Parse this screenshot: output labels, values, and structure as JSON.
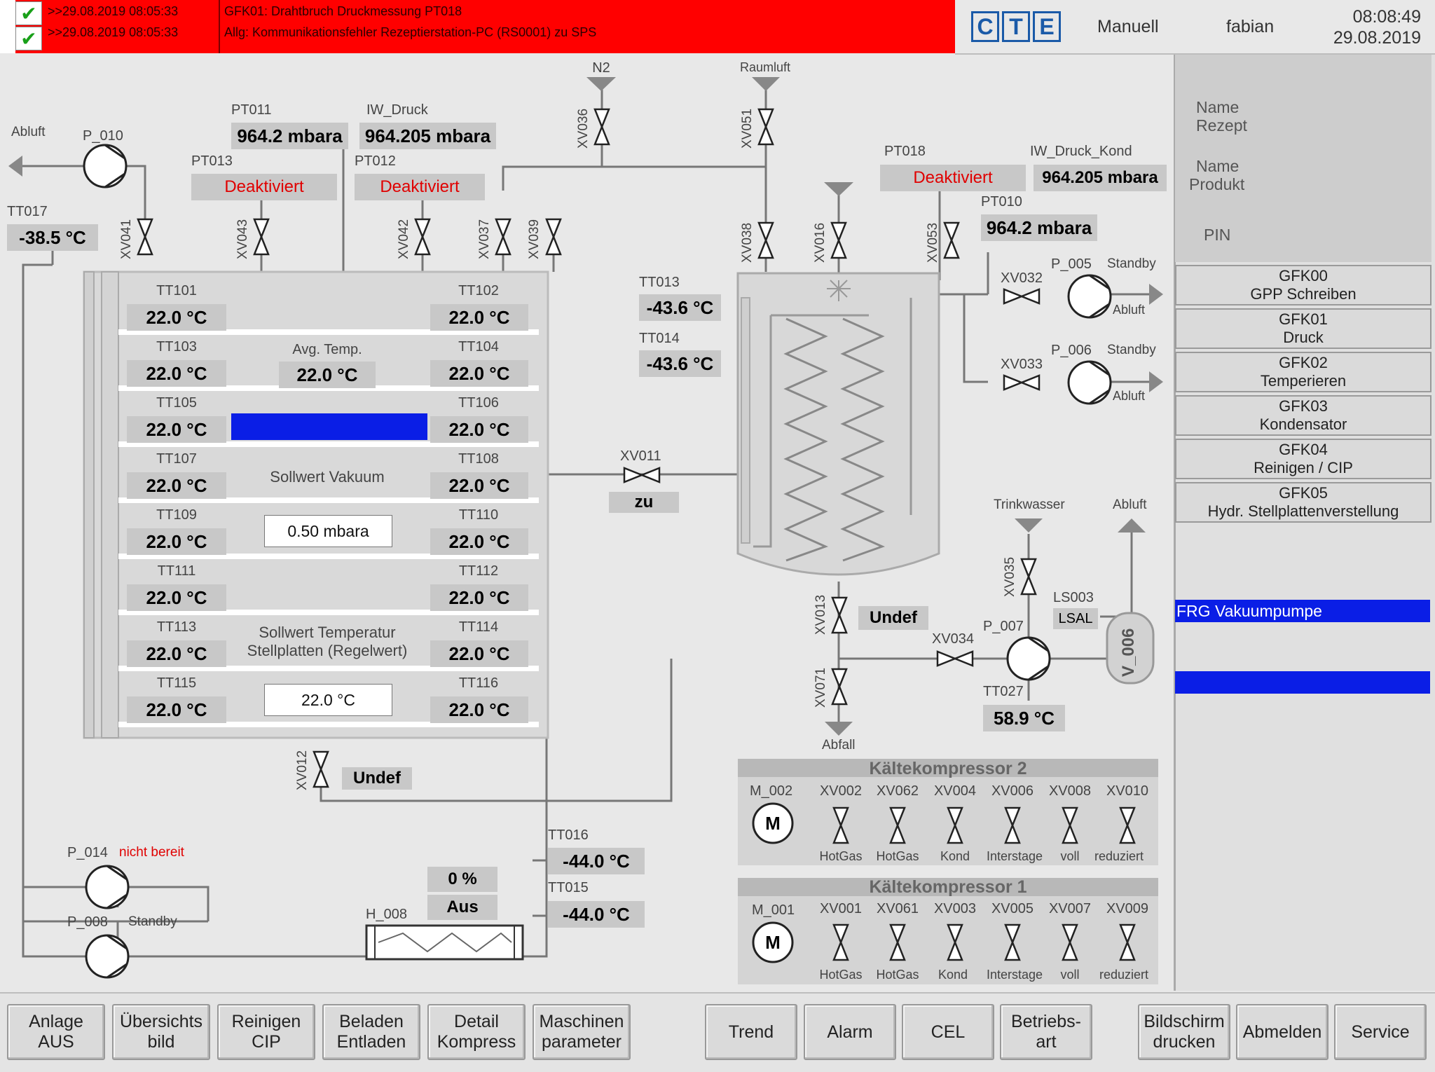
{
  "alarms": [
    {
      "timestamp": ">>29.08.2019 08:05:33",
      "message": "GFK01: Drahtbruch Druckmessung PT018"
    },
    {
      "timestamp": ">>29.08.2019 08:05:33",
      "message": "Allg: Kommunikationsfehler Rezeptierstation-PC (RS0001) zu SPS"
    }
  ],
  "header": {
    "logo": [
      "C",
      "T",
      "E"
    ],
    "mode": "Manuell",
    "user": "fabian",
    "time": "08:08:49",
    "date": "29.08.2019"
  },
  "side": {
    "name_rezept": [
      "Name",
      "Rezept"
    ],
    "name_produkt": [
      "Name",
      "Produkt"
    ],
    "pin": "PIN",
    "buttons": [
      {
        "line1": "GFK00",
        "line2": "GPP Schreiben"
      },
      {
        "line1": "GFK01",
        "line2": "Druck"
      },
      {
        "line1": "GFK02",
        "line2": "Temperieren"
      },
      {
        "line1": "GFK03",
        "line2": "Kondensator"
      },
      {
        "line1": "GFK04",
        "line2": "Reinigen / CIP"
      },
      {
        "line1": "GFK05",
        "line2": "Hydr. Stellplattenverstellung"
      }
    ],
    "frg": "FRG Vakuumpumpe"
  },
  "process": {
    "abluft_left": "Abluft",
    "p010": "P_010",
    "tt017": {
      "tag": "TT017",
      "value": "-38.5 °C"
    },
    "pt011": {
      "tag": "PT011",
      "value": "964.2 mbara"
    },
    "iw_druck": {
      "tag": "IW_Druck",
      "value": "964.205 mbara"
    },
    "pt013": {
      "tag": "PT013",
      "value": "Deaktiviert"
    },
    "pt012": {
      "tag": "PT012",
      "value": "Deaktiviert"
    },
    "n2": "N2",
    "raumluft": "Raumluft",
    "valves": {
      "xv041": "XV041",
      "xv043": "XV043",
      "xv042": "XV042",
      "xv037": "XV037",
      "xv039": "XV039",
      "xv036": "XV036",
      "xv051": "XV051",
      "xv038": "XV038",
      "xv016": "XV016",
      "xv053": "XV053",
      "xv013": "XV013",
      "xv071": "XV071",
      "xv035": "XV035",
      "xv012": "XV012"
    },
    "pt018": {
      "tag": "PT018",
      "value": "Deaktiviert"
    },
    "iw_druck_kond": {
      "tag": "IW_Druck_Kond",
      "value": "964.205 mbara"
    },
    "pt010": {
      "tag": "PT010",
      "value": "964.2 mbara"
    },
    "xv032": "XV032",
    "p005": {
      "tag": "P_005",
      "state": "Standby",
      "out": "Abluft"
    },
    "xv033": "XV033",
    "p006": {
      "tag": "P_006",
      "state": "Standby",
      "out": "Abluft"
    },
    "tt013": {
      "tag": "TT013",
      "value": "-43.6 °C"
    },
    "tt014": {
      "tag": "TT014",
      "value": "-43.6 °C"
    },
    "xv011": {
      "tag": "XV011",
      "value": "zu"
    },
    "xv013_state": "Undef",
    "xv012_state": "Undef",
    "trinkwasser": "Trinkwasser",
    "abluft_right": "Abluft",
    "ls003": {
      "tag": "LS003",
      "value": "LSAL"
    },
    "p007": "P_007",
    "xv034": "XV034",
    "v006": "V_006",
    "tt027": {
      "tag": "TT027",
      "value": "58.9 °C"
    },
    "abfall": "Abfall",
    "tt016": {
      "tag": "TT016",
      "value": "-44.0 °C"
    },
    "tt015": {
      "tag": "TT015",
      "value": "-44.0 °C"
    },
    "p014": {
      "tag": "P_014",
      "state": "nicht bereit"
    },
    "p008": {
      "tag": "P_008",
      "state": "Standby"
    },
    "h008": {
      "tag": "H_008",
      "percent": "0 %",
      "state": "Aus"
    }
  },
  "shelves": {
    "rows": [
      {
        "left_tag": "TT101",
        "left_val": "22.0 °C",
        "right_tag": "TT102",
        "right_val": "22.0 °C"
      },
      {
        "left_tag": "TT103",
        "left_val": "22.0 °C",
        "right_tag": "TT104",
        "right_val": "22.0 °C"
      },
      {
        "left_tag": "TT105",
        "left_val": "22.0 °C",
        "right_tag": "TT106",
        "right_val": "22.0 °C"
      },
      {
        "left_tag": "TT107",
        "left_val": "22.0 °C",
        "right_tag": "TT108",
        "right_val": "22.0 °C"
      },
      {
        "left_tag": "TT109",
        "left_val": "22.0 °C",
        "right_tag": "TT110",
        "right_val": "22.0 °C"
      },
      {
        "left_tag": "TT111",
        "left_val": "22.0 °C",
        "right_tag": "TT112",
        "right_val": "22.0 °C"
      },
      {
        "left_tag": "TT113",
        "left_val": "22.0 °C",
        "right_tag": "TT114",
        "right_val": "22.0 °C"
      },
      {
        "left_tag": "TT115",
        "left_val": "22.0 °C",
        "right_tag": "TT116",
        "right_val": "22.0 °C"
      }
    ],
    "avg_label": "Avg. Temp.",
    "avg_value": "22.0 °C",
    "sollwert_vakuum_label": "Sollwert Vakuum",
    "sollwert_vakuum_value": "0.50 mbara",
    "sollwert_temp_label": [
      "Sollwert Temperatur",
      "Stellplatten (Regelwert)"
    ],
    "sollwert_temp_value": "22.0 °C"
  },
  "compressors": [
    {
      "title": "Kältekompressor 2",
      "motor": "M_002",
      "valves": [
        "XV002",
        "XV062",
        "XV004",
        "XV006",
        "XV008",
        "XV010"
      ],
      "labels": [
        "HotGas",
        "HotGas",
        "Kond",
        "Interstage",
        "voll",
        "reduziert"
      ]
    },
    {
      "title": "Kältekompressor 1",
      "motor": "M_001",
      "valves": [
        "XV001",
        "XV061",
        "XV003",
        "XV005",
        "XV007",
        "XV009"
      ],
      "labels": [
        "HotGas",
        "HotGas",
        "Kond",
        "Interstage",
        "voll",
        "reduziert"
      ]
    }
  ],
  "motor_symbol": "M",
  "footer": [
    [
      "Anlage",
      "AUS"
    ],
    [
      "Übersichts",
      "bild"
    ],
    [
      "Reinigen",
      "CIP"
    ],
    [
      "Beladen",
      "Entladen"
    ],
    [
      "Detail",
      "Kompress"
    ],
    [
      "Maschinen",
      "parameter"
    ],
    [
      "Trend"
    ],
    [
      "Alarm"
    ],
    [
      "CEL"
    ],
    [
      "Betriebs-",
      "art"
    ],
    [
      "Bildschirm",
      "drucken"
    ],
    [
      "Abmelden"
    ],
    [
      "Service"
    ]
  ],
  "colors": {
    "alarm_red": "#ff0000",
    "frg_blue": "#0a1ee6",
    "deaktiviert": "#e00000",
    "value_bg": "#c8c8c8"
  }
}
